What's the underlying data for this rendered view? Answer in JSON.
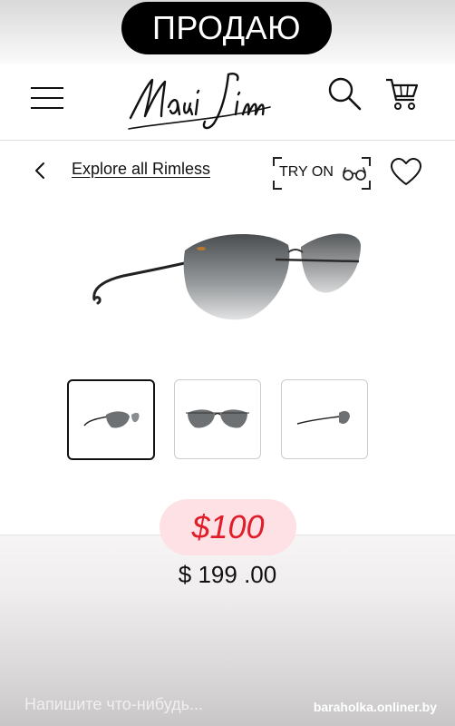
{
  "sticker": {
    "label": "ПРОДАЮ"
  },
  "header": {
    "logo_text": "Maui Jim",
    "menu_icon": "hamburger-icon",
    "search_icon": "search-icon",
    "cart_icon": "cart-icon"
  },
  "nav": {
    "back_icon": "chevron-left-icon",
    "explore_label": "Explore all Rimless",
    "try_on_label": "TRY ON",
    "try_on_icon": "glasses-icon",
    "wishlist_icon": "heart-icon"
  },
  "product": {
    "thumbnails": [
      "side",
      "front",
      "profile"
    ],
    "selected_thumbnail": 0,
    "price_badge": "$100",
    "price": "$ 199 .00"
  },
  "story": {
    "message_placeholder": "Напишите что-нибудь...",
    "watermark": "baraholka.onliner.by"
  },
  "colors": {
    "badge_bg": "#fde1e4",
    "badge_text": "#e11d2a",
    "sticker_bg": "#000000"
  }
}
